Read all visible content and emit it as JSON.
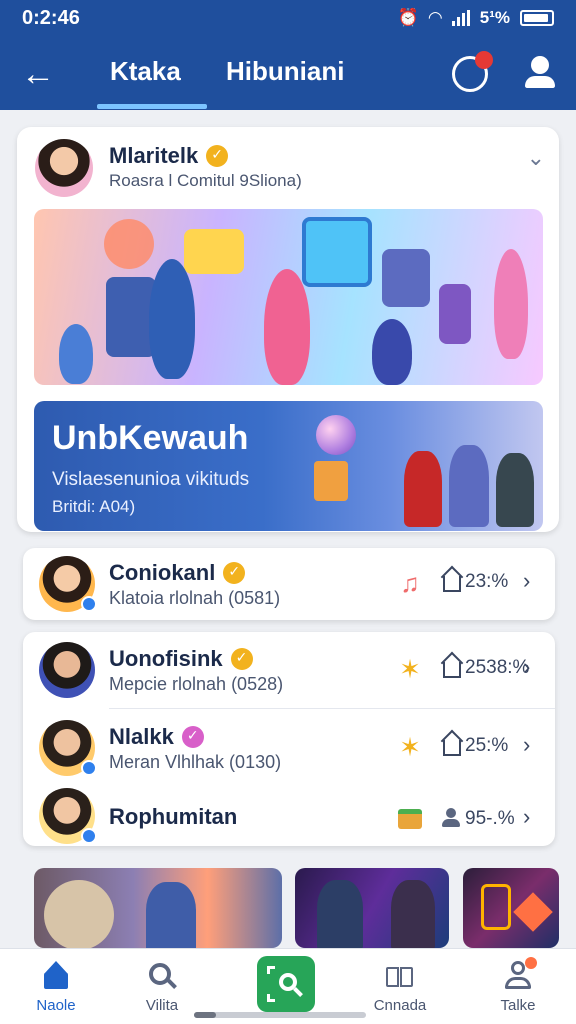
{
  "status_bar": {
    "time": "0:2:46",
    "battery": "5¹%"
  },
  "header": {
    "back_icon": "arrow-left-icon",
    "tabs": [
      {
        "label": "Ktaka",
        "active": true
      },
      {
        "label": "Hibuniani",
        "active": false
      }
    ],
    "notification_icon": "notification-icon",
    "profile_icon": "profile-icon",
    "colors": {
      "bar": "#1f4f9d",
      "underline": "#7cc4ff"
    }
  },
  "feature": {
    "title": "Mlaritelk",
    "subtitle": "Roasra l Comitul 9Sliona)",
    "promo": {
      "title": "UnbKewauh",
      "line1": "Vislaesenunioa vikituds",
      "line2": "Britdi: A04)"
    }
  },
  "list": [
    {
      "name": "Coniokanl",
      "sub": "Klatoia rlolnah (0581)",
      "icon": "music-note-icon",
      "stat": "23:% ",
      "badge_color": "#f2b21e"
    },
    {
      "name": "Uonofisink",
      "sub": "Mepcie rlolnah (0528)",
      "icon": "sparkle-icon",
      "stat": "2538:%",
      "badge_color": "#f2b21e"
    },
    {
      "name": "Nlalkk",
      "sub": "Meran Vlhlhak (0130)",
      "icon": "sparkle-icon",
      "stat": "25:%",
      "badge_color": "#d85fc9"
    },
    {
      "name": "Rophumitan",
      "sub": "",
      "icon": "wallet-icon",
      "stat": "95-.%",
      "badge_color": ""
    }
  ],
  "bottom_nav": {
    "items": [
      {
        "label": "Naole",
        "icon": "home-icon",
        "active": true
      },
      {
        "label": "Vilita",
        "icon": "search-icon",
        "active": false
      },
      {
        "label": "",
        "icon": "scan-search-icon",
        "active": false
      },
      {
        "label": "Cnnada",
        "icon": "book-icon",
        "active": false
      },
      {
        "label": "Talke",
        "icon": "user-icon",
        "active": false
      }
    ],
    "center_color": "#27a558"
  }
}
